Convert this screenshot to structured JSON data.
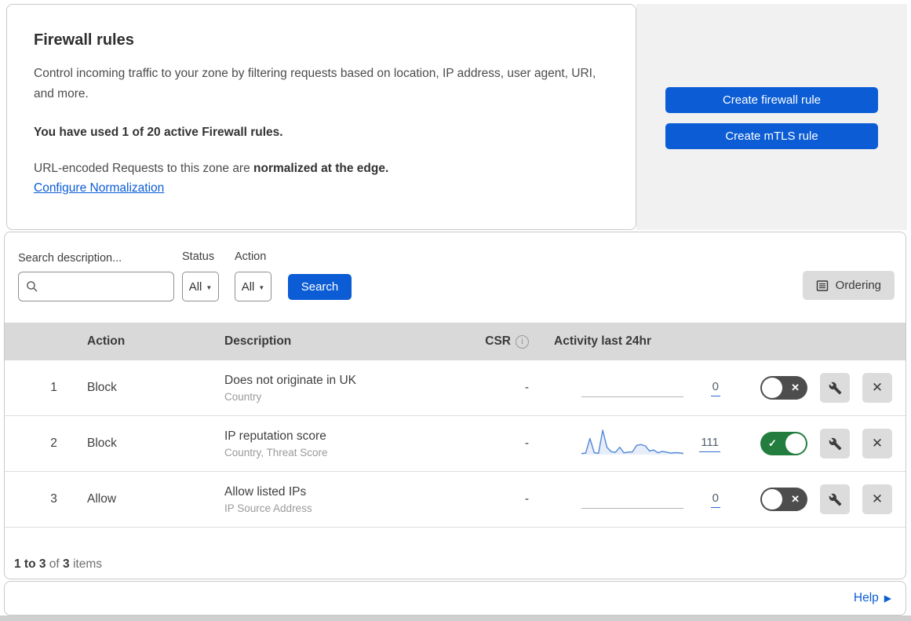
{
  "colors": {
    "primary_blue": "#0b5cd5",
    "link_blue": "#0b5cd5",
    "toggle_on_green": "#227d3f",
    "toggle_off_gray": "#4d4d4d",
    "table_header_gray": "#d9d9d9",
    "side_panel_gray": "#f1f1f1",
    "icon_button_gray": "#dcdcdc",
    "sparkline_blue": "#5b8dd9"
  },
  "icons": {
    "search_icon": "magnifier",
    "dropdown_arrow": "▼",
    "ordering_icon": "list-document",
    "info_icon": "i",
    "wrench_icon": "wrench",
    "close_icon": "✕",
    "toggle_off_symbol": "✕",
    "toggle_on_symbol": "✓",
    "help_arrow": "▶"
  },
  "header": {
    "title": "Firewall rules",
    "description": "Control incoming traffic to your zone by filtering requests based on location, IP address, user agent, URI, and more.",
    "usage_note": "You have used 1 of 20 active Firewall rules.",
    "normalization_prefix": "URL-encoded Requests to this zone are ",
    "normalization_bold": "normalized at the edge.",
    "normalization_link": "Configure Normalization",
    "buttons": {
      "create_firewall_rule": "Create firewall rule",
      "create_mtls_rule": "Create mTLS rule"
    }
  },
  "filters": {
    "search_label": "Search description...",
    "search_value": "",
    "status_label": "Status",
    "status_value": "All",
    "action_label": "Action",
    "action_value": "All",
    "search_button": "Search",
    "ordering_button": "Ordering"
  },
  "table": {
    "columns": {
      "action": "Action",
      "description": "Description",
      "csr": "CSR",
      "activity": "Activity last 24hr"
    },
    "rows": [
      {
        "priority": "1",
        "action": "Block",
        "description": "Does not originate in UK",
        "fields": "Country",
        "csr": "-",
        "count": "0",
        "enabled": false,
        "sparkline": null
      },
      {
        "priority": "2",
        "action": "Block",
        "description": "IP reputation score",
        "fields": "Country, Threat Score",
        "csr": "-",
        "count": "111",
        "enabled": true,
        "sparkline": [
          4,
          6,
          66,
          8,
          5,
          100,
          30,
          12,
          9,
          30,
          7,
          10,
          11,
          38,
          41,
          36,
          15,
          19,
          7,
          13,
          10,
          6,
          8,
          7,
          5
        ]
      },
      {
        "priority": "3",
        "action": "Allow",
        "description": "Allow listed IPs",
        "fields": "IP Source Address",
        "csr": "-",
        "count": "0",
        "enabled": false,
        "sparkline": null
      }
    ]
  },
  "footer": {
    "range": "1 to 3",
    "of": "of",
    "total": "3",
    "items": "items"
  },
  "help": {
    "label": "Help"
  }
}
